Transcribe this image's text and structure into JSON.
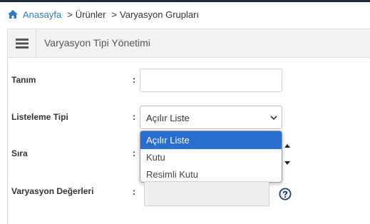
{
  "breadcrumb": {
    "home": "Anasayfa",
    "items": [
      "Ürünler",
      "Varyasyon Grupları"
    ]
  },
  "panel": {
    "title": "Varyasyon Tipi Yönetimi"
  },
  "form": {
    "colon": ":",
    "tanim_label": "Tanım",
    "listeleme_label": "Listeleme Tipi",
    "listeleme_value": "Açılır Liste",
    "listeleme_options": [
      "Açılır Liste",
      "Kutu",
      "Resimli Kutu"
    ],
    "sira_label": "Sıra",
    "degerler_label": "Varyasyon Değerleri"
  },
  "icons": {
    "home": "home-icon",
    "menu": "hamburger-icon",
    "chevron": "chevron-down-icon",
    "help": "question-circle-icon"
  },
  "colors": {
    "link": "#2f7ac7",
    "selected": "#2a6ed0",
    "header_bg": "#f2f2f2"
  }
}
